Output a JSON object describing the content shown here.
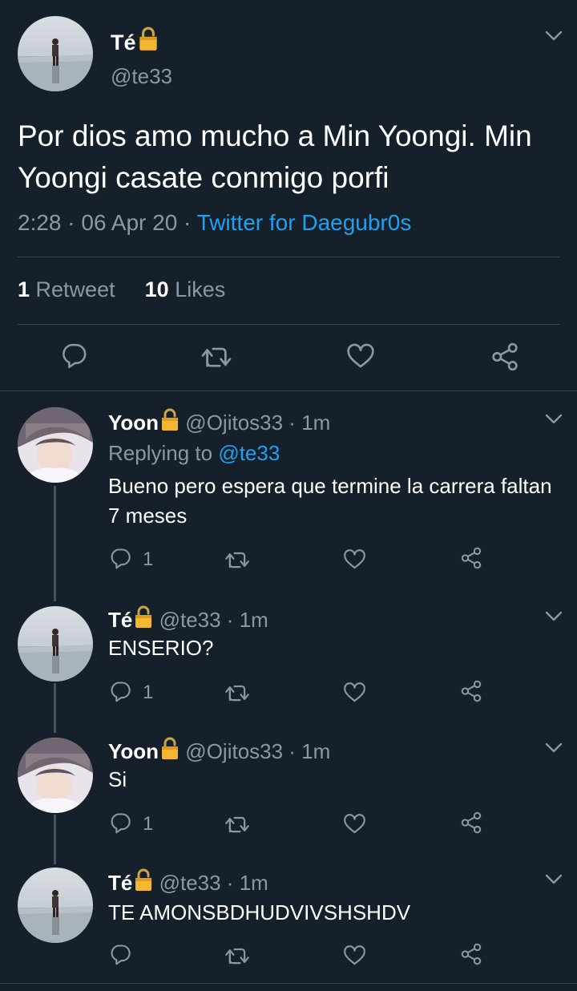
{
  "colors": {
    "background": "#15202b",
    "accent": "#1da1f2",
    "secondary_text": "#8899a6",
    "divider": "#38444d"
  },
  "main_tweet": {
    "author_name": "Té",
    "author_badge": "lock-icon",
    "handle": "@te33",
    "text": "Por dios amo mucho a Min Yoongi. Min Yoongi casate conmigo porfi",
    "time": "2:28",
    "date": "06 Apr 20",
    "source": "Twitter for Daegubr0s",
    "retweets_count": "1",
    "retweets_label": "Retweet",
    "likes_count": "10",
    "likes_label": "Likes",
    "actions": [
      "reply-icon",
      "retweet-icon",
      "like-icon",
      "share-icon"
    ]
  },
  "replies": [
    {
      "author_name": "Yoon",
      "handle": "@Ojitos33",
      "time": "1m",
      "replying_label": "Replying to",
      "replying_to": "@te33",
      "text": "Bueno pero espera que termine la carrera faltan 7 meses",
      "reply_count": "1"
    },
    {
      "author_name": "Té",
      "handle": "@te33",
      "time": "1m",
      "text": "ENSERIO?",
      "reply_count": "1"
    },
    {
      "author_name": "Yoon",
      "handle": "@Ojitos33",
      "time": "1m",
      "text": "Si",
      "reply_count": "1"
    },
    {
      "author_name": "Té",
      "handle": "@te33",
      "time": "1m",
      "text": "TE AMONSBDHUDVIVSHSHDV",
      "reply_count": ""
    }
  ]
}
